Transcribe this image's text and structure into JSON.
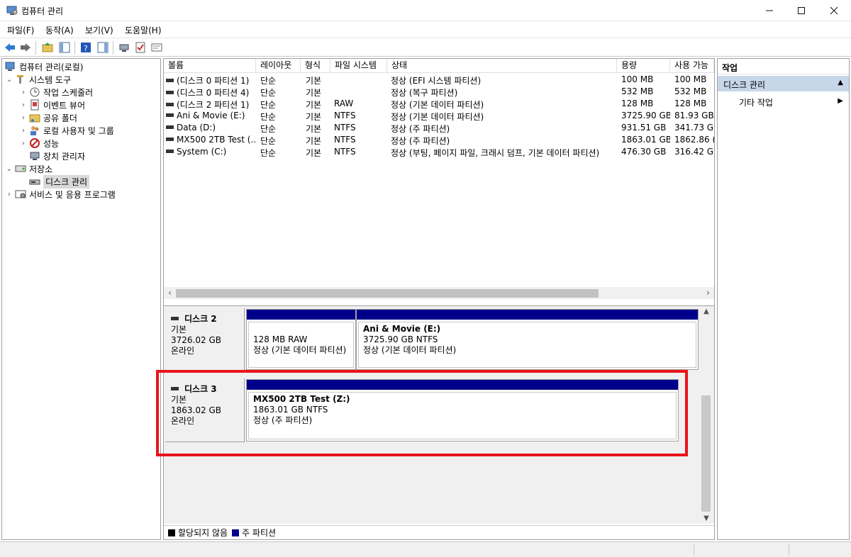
{
  "window": {
    "title": "컴퓨터 관리"
  },
  "menu": [
    "파일(F)",
    "동작(A)",
    "보기(V)",
    "도움말(H)"
  ],
  "toolbar": {
    "icons": [
      "back-arrow",
      "forward-arrow",
      "up-folder",
      "show-hide-tree",
      "help",
      "show-hide-action",
      "connect",
      "checklist",
      "properties"
    ]
  },
  "tree": {
    "root": "컴퓨터 관리(로컬)",
    "system_tools": "시스템 도구",
    "task_scheduler": "작업 스케줄러",
    "event_viewer": "이벤트 뷰어",
    "shared_folders": "공유 폴더",
    "local_users": "로컬 사용자 및 그룹",
    "performance": "성능",
    "device_manager": "장치 관리자",
    "storage": "저장소",
    "disk_management": "디스크 관리",
    "services": "서비스 및 응용 프로그램"
  },
  "volume_list": {
    "columns": [
      "볼륨",
      "레이아웃",
      "형식",
      "파일 시스템",
      "상태",
      "용량",
      "사용 가능"
    ],
    "rows": [
      {
        "volume": "(디스크 0 파티션 1)",
        "layout": "단순",
        "type": "기본",
        "fs": "",
        "status": "정상 (EFI 시스템 파티션)",
        "capacity": "100 MB",
        "free": "100 MB"
      },
      {
        "volume": "(디스크 0 파티션 4)",
        "layout": "단순",
        "type": "기본",
        "fs": "",
        "status": "정상 (복구 파티션)",
        "capacity": "532 MB",
        "free": "532 MB"
      },
      {
        "volume": "(디스크 2 파티션 1)",
        "layout": "단순",
        "type": "기본",
        "fs": "RAW",
        "status": "정상 (기본 데이터 파티션)",
        "capacity": "128 MB",
        "free": "128 MB"
      },
      {
        "volume": "Ani & Movie (E:)",
        "layout": "단순",
        "type": "기본",
        "fs": "NTFS",
        "status": "정상 (기본 데이터 파티션)",
        "capacity": "3725.90 GB",
        "free": "81.93 GB"
      },
      {
        "volume": "Data (D:)",
        "layout": "단순",
        "type": "기본",
        "fs": "NTFS",
        "status": "정상 (주 파티션)",
        "capacity": "931.51 GB",
        "free": "341.73 G"
      },
      {
        "volume": "MX500 2TB Test (...",
        "layout": "단순",
        "type": "기본",
        "fs": "NTFS",
        "status": "정상 (주 파티션)",
        "capacity": "1863.01 GB",
        "free": "1862.86 ("
      },
      {
        "volume": "System (C:)",
        "layout": "단순",
        "type": "기본",
        "fs": "NTFS",
        "status": "정상 (부팅, 페이지 파일, 크래시 덤프, 기본 데이터 파티션)",
        "capacity": "476.30 GB",
        "free": "316.42 GI"
      }
    ]
  },
  "disks": [
    {
      "name": "디스크 2",
      "kind": "기본",
      "size": "3726.02 GB",
      "state": "온라인",
      "partitions": [
        {
          "title": "",
          "line1": "128 MB RAW",
          "line2": "정상 (기본 데이터 파티션)"
        },
        {
          "title": "Ani & Movie  (E:)",
          "line1": "3725.90 GB NTFS",
          "line2": "정상 (기본 데이터 파티션)"
        }
      ]
    },
    {
      "name": "디스크 3",
      "kind": "기본",
      "size": "1863.02 GB",
      "state": "온라인",
      "partitions": [
        {
          "title": "MX500 2TB Test  (Z:)",
          "line1": "1863.01 GB NTFS",
          "line2": "정상 (주 파티션)"
        }
      ]
    }
  ],
  "legend": {
    "unallocated": "할당되지 않음",
    "primary": "주 파티션",
    "unallocated_color": "#000000",
    "primary_color": "#00008b"
  },
  "actions": {
    "header": "작업",
    "section": "디스크 관리",
    "more": "기타 작업"
  },
  "colors": {
    "partition_bar": "#00008b",
    "highlight": "#e8141a",
    "selection": "#c7d7ea"
  }
}
